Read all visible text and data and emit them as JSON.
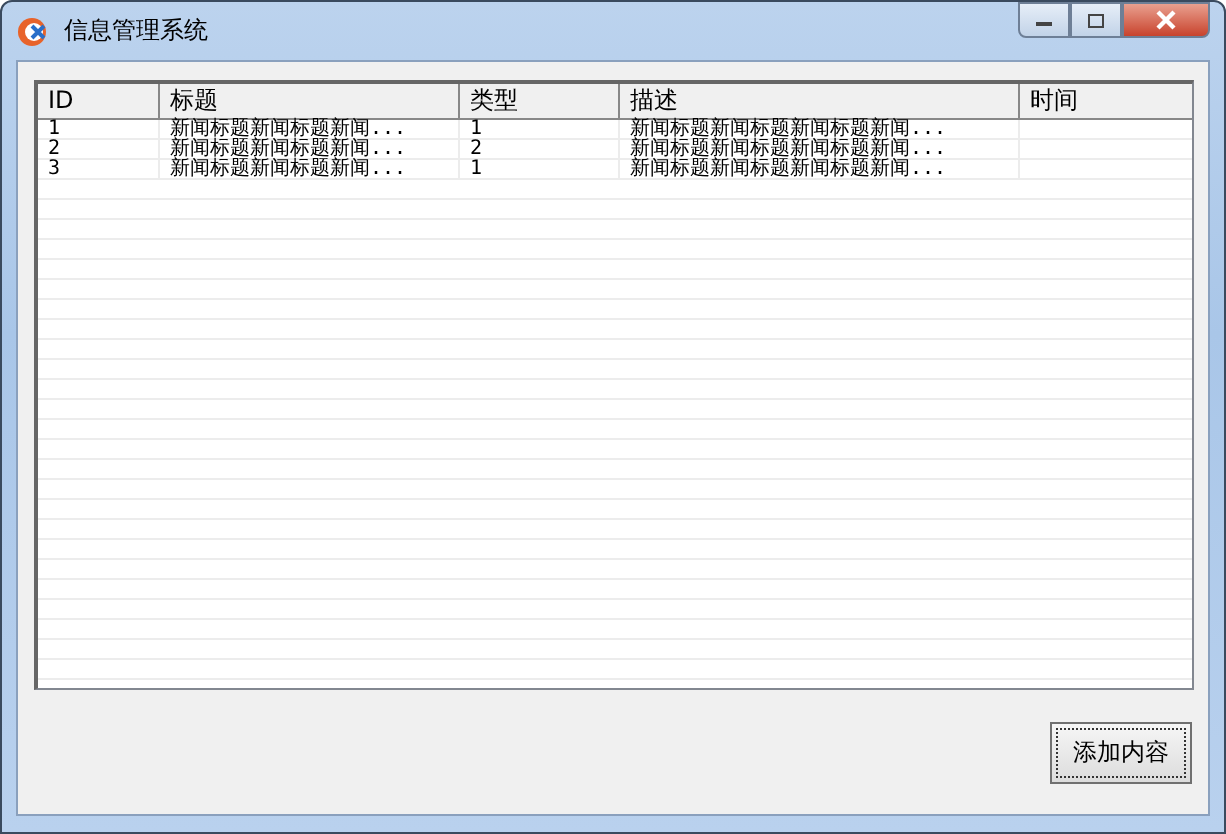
{
  "window": {
    "title": "信息管理系统"
  },
  "table": {
    "columns": [
      "ID",
      "标题",
      "类型",
      "描述",
      "时间"
    ],
    "rows": [
      [
        "1",
        "新闻标题新闻标题新闻...",
        "1",
        "新闻标题新闻标题新闻标题新闻...",
        ""
      ],
      [
        "2",
        "新闻标题新闻标题新闻...",
        "2",
        "新闻标题新闻标题新闻标题新闻...",
        ""
      ],
      [
        "3",
        "新闻标题新闻标题新闻...",
        "1",
        "新闻标题新闻标题新闻标题新闻...",
        ""
      ]
    ]
  },
  "buttons": [
    "添加内容"
  ]
}
